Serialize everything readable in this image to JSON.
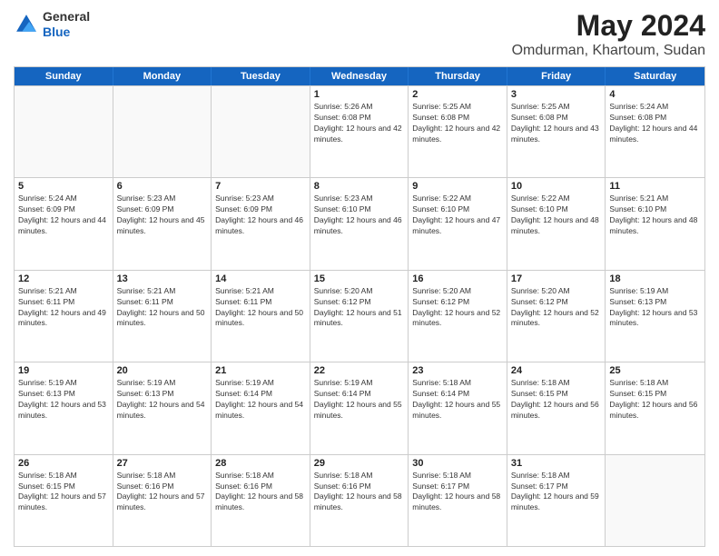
{
  "logo": {
    "general": "General",
    "blue": "Blue"
  },
  "title": {
    "month": "May 2024",
    "location": "Omdurman, Khartoum, Sudan"
  },
  "weekdays": [
    "Sunday",
    "Monday",
    "Tuesday",
    "Wednesday",
    "Thursday",
    "Friday",
    "Saturday"
  ],
  "rows": [
    [
      {
        "day": "",
        "sunrise": "",
        "sunset": "",
        "daylight": "",
        "empty": true
      },
      {
        "day": "",
        "sunrise": "",
        "sunset": "",
        "daylight": "",
        "empty": true
      },
      {
        "day": "",
        "sunrise": "",
        "sunset": "",
        "daylight": "",
        "empty": true
      },
      {
        "day": "1",
        "sunrise": "Sunrise: 5:26 AM",
        "sunset": "Sunset: 6:08 PM",
        "daylight": "Daylight: 12 hours and 42 minutes.",
        "empty": false
      },
      {
        "day": "2",
        "sunrise": "Sunrise: 5:25 AM",
        "sunset": "Sunset: 6:08 PM",
        "daylight": "Daylight: 12 hours and 42 minutes.",
        "empty": false
      },
      {
        "day": "3",
        "sunrise": "Sunrise: 5:25 AM",
        "sunset": "Sunset: 6:08 PM",
        "daylight": "Daylight: 12 hours and 43 minutes.",
        "empty": false
      },
      {
        "day": "4",
        "sunrise": "Sunrise: 5:24 AM",
        "sunset": "Sunset: 6:08 PM",
        "daylight": "Daylight: 12 hours and 44 minutes.",
        "empty": false
      }
    ],
    [
      {
        "day": "5",
        "sunrise": "Sunrise: 5:24 AM",
        "sunset": "Sunset: 6:09 PM",
        "daylight": "Daylight: 12 hours and 44 minutes.",
        "empty": false
      },
      {
        "day": "6",
        "sunrise": "Sunrise: 5:23 AM",
        "sunset": "Sunset: 6:09 PM",
        "daylight": "Daylight: 12 hours and 45 minutes.",
        "empty": false
      },
      {
        "day": "7",
        "sunrise": "Sunrise: 5:23 AM",
        "sunset": "Sunset: 6:09 PM",
        "daylight": "Daylight: 12 hours and 46 minutes.",
        "empty": false
      },
      {
        "day": "8",
        "sunrise": "Sunrise: 5:23 AM",
        "sunset": "Sunset: 6:10 PM",
        "daylight": "Daylight: 12 hours and 46 minutes.",
        "empty": false
      },
      {
        "day": "9",
        "sunrise": "Sunrise: 5:22 AM",
        "sunset": "Sunset: 6:10 PM",
        "daylight": "Daylight: 12 hours and 47 minutes.",
        "empty": false
      },
      {
        "day": "10",
        "sunrise": "Sunrise: 5:22 AM",
        "sunset": "Sunset: 6:10 PM",
        "daylight": "Daylight: 12 hours and 48 minutes.",
        "empty": false
      },
      {
        "day": "11",
        "sunrise": "Sunrise: 5:21 AM",
        "sunset": "Sunset: 6:10 PM",
        "daylight": "Daylight: 12 hours and 48 minutes.",
        "empty": false
      }
    ],
    [
      {
        "day": "12",
        "sunrise": "Sunrise: 5:21 AM",
        "sunset": "Sunset: 6:11 PM",
        "daylight": "Daylight: 12 hours and 49 minutes.",
        "empty": false
      },
      {
        "day": "13",
        "sunrise": "Sunrise: 5:21 AM",
        "sunset": "Sunset: 6:11 PM",
        "daylight": "Daylight: 12 hours and 50 minutes.",
        "empty": false
      },
      {
        "day": "14",
        "sunrise": "Sunrise: 5:21 AM",
        "sunset": "Sunset: 6:11 PM",
        "daylight": "Daylight: 12 hours and 50 minutes.",
        "empty": false
      },
      {
        "day": "15",
        "sunrise": "Sunrise: 5:20 AM",
        "sunset": "Sunset: 6:12 PM",
        "daylight": "Daylight: 12 hours and 51 minutes.",
        "empty": false
      },
      {
        "day": "16",
        "sunrise": "Sunrise: 5:20 AM",
        "sunset": "Sunset: 6:12 PM",
        "daylight": "Daylight: 12 hours and 52 minutes.",
        "empty": false
      },
      {
        "day": "17",
        "sunrise": "Sunrise: 5:20 AM",
        "sunset": "Sunset: 6:12 PM",
        "daylight": "Daylight: 12 hours and 52 minutes.",
        "empty": false
      },
      {
        "day": "18",
        "sunrise": "Sunrise: 5:19 AM",
        "sunset": "Sunset: 6:13 PM",
        "daylight": "Daylight: 12 hours and 53 minutes.",
        "empty": false
      }
    ],
    [
      {
        "day": "19",
        "sunrise": "Sunrise: 5:19 AM",
        "sunset": "Sunset: 6:13 PM",
        "daylight": "Daylight: 12 hours and 53 minutes.",
        "empty": false
      },
      {
        "day": "20",
        "sunrise": "Sunrise: 5:19 AM",
        "sunset": "Sunset: 6:13 PM",
        "daylight": "Daylight: 12 hours and 54 minutes.",
        "empty": false
      },
      {
        "day": "21",
        "sunrise": "Sunrise: 5:19 AM",
        "sunset": "Sunset: 6:14 PM",
        "daylight": "Daylight: 12 hours and 54 minutes.",
        "empty": false
      },
      {
        "day": "22",
        "sunrise": "Sunrise: 5:19 AM",
        "sunset": "Sunset: 6:14 PM",
        "daylight": "Daylight: 12 hours and 55 minutes.",
        "empty": false
      },
      {
        "day": "23",
        "sunrise": "Sunrise: 5:18 AM",
        "sunset": "Sunset: 6:14 PM",
        "daylight": "Daylight: 12 hours and 55 minutes.",
        "empty": false
      },
      {
        "day": "24",
        "sunrise": "Sunrise: 5:18 AM",
        "sunset": "Sunset: 6:15 PM",
        "daylight": "Daylight: 12 hours and 56 minutes.",
        "empty": false
      },
      {
        "day": "25",
        "sunrise": "Sunrise: 5:18 AM",
        "sunset": "Sunset: 6:15 PM",
        "daylight": "Daylight: 12 hours and 56 minutes.",
        "empty": false
      }
    ],
    [
      {
        "day": "26",
        "sunrise": "Sunrise: 5:18 AM",
        "sunset": "Sunset: 6:15 PM",
        "daylight": "Daylight: 12 hours and 57 minutes.",
        "empty": false
      },
      {
        "day": "27",
        "sunrise": "Sunrise: 5:18 AM",
        "sunset": "Sunset: 6:16 PM",
        "daylight": "Daylight: 12 hours and 57 minutes.",
        "empty": false
      },
      {
        "day": "28",
        "sunrise": "Sunrise: 5:18 AM",
        "sunset": "Sunset: 6:16 PM",
        "daylight": "Daylight: 12 hours and 58 minutes.",
        "empty": false
      },
      {
        "day": "29",
        "sunrise": "Sunrise: 5:18 AM",
        "sunset": "Sunset: 6:16 PM",
        "daylight": "Daylight: 12 hours and 58 minutes.",
        "empty": false
      },
      {
        "day": "30",
        "sunrise": "Sunrise: 5:18 AM",
        "sunset": "Sunset: 6:17 PM",
        "daylight": "Daylight: 12 hours and 58 minutes.",
        "empty": false
      },
      {
        "day": "31",
        "sunrise": "Sunrise: 5:18 AM",
        "sunset": "Sunset: 6:17 PM",
        "daylight": "Daylight: 12 hours and 59 minutes.",
        "empty": false
      },
      {
        "day": "",
        "sunrise": "",
        "sunset": "",
        "daylight": "",
        "empty": true
      }
    ]
  ]
}
